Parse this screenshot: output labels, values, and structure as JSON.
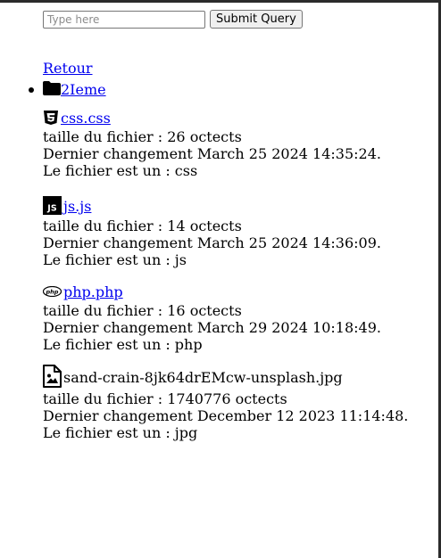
{
  "search": {
    "placeholder": "Type here",
    "button_label": "Submit Query"
  },
  "nav": {
    "back_label": "Retour"
  },
  "folders": [
    {
      "name": "2Ieme"
    }
  ],
  "files": [
    {
      "name": " css.css",
      "size_text": "taille du fichier : 26 octects",
      "modified_text": "Dernier changement March 25 2024 14:35:24.",
      "type_text": "Le fichier est un : css",
      "icon": "css3-icon",
      "is_link": true
    },
    {
      "name": " js.js",
      "size_text": "taille du fichier : 14 octects",
      "modified_text": "Dernier changement March 25 2024 14:36:09.",
      "type_text": "Le fichier est un : js",
      "icon": "js-icon",
      "is_link": true
    },
    {
      "name": " php.php",
      "size_text": "taille du fichier : 16 octects",
      "modified_text": "Dernier changement March 29 2024 10:18:49.",
      "type_text": "Le fichier est un : php",
      "icon": "php-icon",
      "is_link": true
    },
    {
      "name": " sand-crain-8jk64drEMcw-unsplash.jpg",
      "size_text": "taille du fichier : 1740776 octects",
      "modified_text": "Dernier changement December 12 2023 11:14:48.",
      "type_text": "Le fichier est un : jpg",
      "icon": "image-file-icon",
      "is_link": false
    }
  ],
  "colors": {
    "link": "#0000ee",
    "text": "#000000"
  }
}
